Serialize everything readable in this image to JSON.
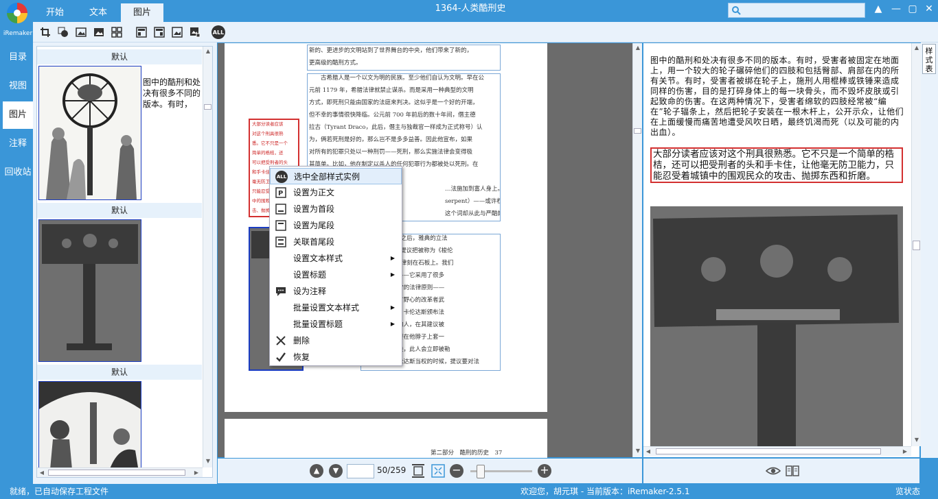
{
  "app": {
    "logo_text": "iRemaker",
    "window_title": "1364-人类酷刑史",
    "tabs": [
      "开始",
      "文本",
      "图片"
    ],
    "active_tab": "图片",
    "search_placeholder": ""
  },
  "window_controls": {
    "pin": "▲",
    "minimize": "—",
    "maximize": "▢",
    "close": "✕"
  },
  "toolbar": {
    "icons": [
      "crop-icon",
      "mask-icon",
      "image-icon",
      "image-alt-icon",
      "grid-select-icon",
      "layout-icon",
      "layout-alt-icon",
      "image-frame-icon",
      "image-export-icon",
      "select-all-icon"
    ],
    "all_label": "ALL"
  },
  "leftnav": {
    "items": [
      {
        "label": "目录"
      },
      {
        "label": "视图"
      },
      {
        "label": "图片"
      },
      {
        "label": "注释"
      },
      {
        "label": "回收站"
      }
    ],
    "active": "图片"
  },
  "thumbnails": [
    {
      "header": "默认",
      "caption": "图中的酷刑和处决有很多不同的版本。有时，"
    },
    {
      "header": "默认",
      "caption": ""
    },
    {
      "header": "默认",
      "caption": ""
    }
  ],
  "document": {
    "lines_top": [
      "新的、更进步的文明站到了世界舞台的中央，他们带来了新的，",
      "更高级的酷刑方式。"
    ],
    "para1": [
      "　　古希腊人是一个以文为明的民族。至少他们自认为文明。早在公",
      "元前 1179 年，希腊法律就禁止谋杀。而是采用一种典型的文明",
      "方式，即死刑只能由国家的法庭来判决。这似乎是一个好的开端，",
      "但不幸的事情很快降临。公元前 700 年前后的数十年间，僭主德",
      "拉古（Tyrant Draco，此后，僭主与独裁官一样成为正式称号）认",
      "为，俩若死刑是好的，那么岂不是多多益善。因此他宣布，如果",
      "对所有的犯罪只处以一种刑罚——死刑，那么实施法律会变得极",
      "其简单。比如，他在制定以杀人的任何犯罪行为都被处以死刑。在"
    ],
    "para2": [
      "…法施加到富人身上。”德拉古——",
      "serpent）——或许权不是太久，",
      "这个词却从此与严酷的法律联系"
    ],
    "para3": [
      "时代的 350 年之后，雅典的立法",
      "Charondas）提议把被称为《梭伦",
      "n Code）的法律刻在石板上。我们",
      "不是法典本身——它采用了很多",
      "行的“以眼还眼”的法律原则——",
      "施。为了防止有野心的改革者武",
      "制定的新法律，卡伦达斯颁布法",
      "提议修改法典的人，在其建议被",
      "讨论的时候，要在他脖子上套一",
      "这个提议被否决，此人会立即被勒",
      "…时间，在卡伦达斯当权的时候，提议要对法"
    ],
    "redbox_lines": [
      "大部分读者应该",
      "对这个刑具很熟",
      "悉。它不只是一个",
      "简单的梏桔，还",
      "可以把受刑者的头",
      "和手卡住，让他",
      "毫无防卫能力，",
      "只能忍受着城镇",
      "中的围观民众的攻",
      "击、抛掷东西和折磨。"
    ],
    "footer": "第二部分　酷刑的历史　37"
  },
  "context_menu": {
    "items": [
      {
        "label": "选中全部样式实例",
        "icon": "all-icon",
        "submenu": false
      },
      {
        "label": "设置为正文",
        "icon": "paragraph-icon",
        "submenu": false
      },
      {
        "label": "设置为首段",
        "icon": "first-paragraph-icon",
        "submenu": false
      },
      {
        "label": "设置为尾段",
        "icon": "last-paragraph-icon",
        "submenu": false
      },
      {
        "label": "关联首尾段",
        "icon": "link-paragraph-icon",
        "submenu": false
      },
      {
        "label": "设置文本样式",
        "icon": "",
        "submenu": true
      },
      {
        "label": "设置标题",
        "icon": "",
        "submenu": true
      },
      {
        "label": "设为注释",
        "icon": "comment-icon",
        "submenu": false
      },
      {
        "label": "批量设置文本样式",
        "icon": "",
        "submenu": true
      },
      {
        "label": "批量设置标题",
        "icon": "",
        "submenu": true
      },
      {
        "label": "删除",
        "icon": "close-icon",
        "submenu": false
      },
      {
        "label": "恢复",
        "icon": "check-icon",
        "submenu": false
      }
    ],
    "all_label": "ALL",
    "submenu_arrow": "▶"
  },
  "preview": {
    "text1": "图中的酷刑和处决有很多不同的版本。有时，受害者被固定在地面上，用一个较大的轮子碾碎他们的四肢和包括臀部、肩部在内的所有关节。有时，受害者被绑在轮子上，施刑人用棍棒或铁锤来造成同样的伤害，目的是打碎身体上的每一块骨头，而不毁坏皮肤或引起致命的伤害。在这两种情况下，受害者绵软的四肢经常被“编在”轮子辐条上，然后把轮子安装在一根木杆上，公开示众，让他们在上面缓慢而痛苦地遭受风吹日晒，最终饥渴而死（以及可能的内出血）。",
    "text2": "大部分读者应该对这个刑具很熟悉。它不只是一个简单的梏桔，还可以把受刑者的头和手卡住，让他毫无防卫能力，只能忍受着城镇中的围观民众的攻击、抛掷东西和折磨。"
  },
  "style_tab": {
    "label": "样式表"
  },
  "pagebar": {
    "page_value": "",
    "page_count": "50/259",
    "zoom_level": 0.12
  },
  "statusbar": {
    "left": "就绪，已自动保存工程文件",
    "center": "欢迎您，胡元琪 - 当前版本：iRemaker-2.5.1",
    "right": "览状态"
  },
  "colors": {
    "chrome_blue": "#3a96d8",
    "panel_bg": "#e9f2fb",
    "highlight_red": "#d32f2f",
    "select_blue": "#1a3cc2"
  }
}
